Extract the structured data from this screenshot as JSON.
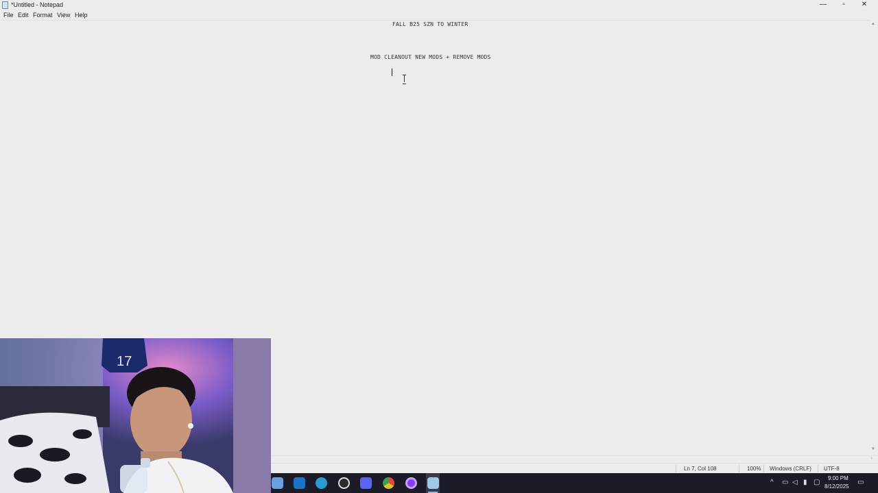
{
  "window": {
    "title": "*Untitled - Notepad",
    "minimize_glyph": "—",
    "maximize_glyph": "▫",
    "close_glyph": "✕"
  },
  "menu": {
    "items": [
      "File",
      "Edit",
      "Format",
      "View",
      "Help"
    ]
  },
  "editor": {
    "lines": [
      "FALL B25 SZN TO WINTER",
      "MOD CLEANOUT NEW MODS + REMOVE MODS"
    ]
  },
  "statusbar": {
    "position": "Ln 7, Col 108",
    "zoom": "100%",
    "line_ending": "Windows (CRLF)",
    "encoding": "UTF-8"
  },
  "taskbar": {
    "apps": [
      {
        "name": "Store",
        "icon": "store-icon",
        "color": "#6aa0e0"
      },
      {
        "name": "Outlook",
        "icon": "outlook-icon",
        "color": "#1a73c8"
      },
      {
        "name": "Edge",
        "icon": "edge-icon",
        "color": "#2a9bd0"
      },
      {
        "name": "Recorder",
        "icon": "obs-icon",
        "color": "#2b2b2b"
      },
      {
        "name": "Discord",
        "icon": "discord-icon",
        "color": "#5865f2"
      },
      {
        "name": "Chrome",
        "icon": "chrome-icon",
        "color": "#e0c030"
      },
      {
        "name": "App",
        "icon": "circle-app-icon",
        "color": "#8a3cf0"
      },
      {
        "name": "Notepad",
        "icon": "notepad-icon",
        "color": "#9ec8e8"
      }
    ],
    "time": "9:00 PM",
    "date": "8/12/2025"
  },
  "webcam": {
    "icon": "webcam-feed"
  }
}
